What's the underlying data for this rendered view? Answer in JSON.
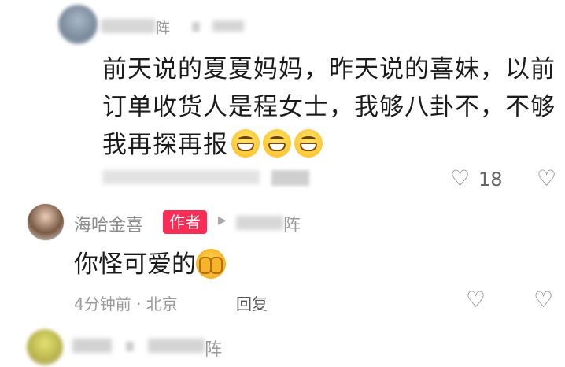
{
  "comment1": {
    "name_tail": "阵",
    "text": "前天说的夏夏妈妈，昨天说的喜妹，以前订单收货人是程女士，我够八卦不，不够我再探再报",
    "like_icon": "heart-outline-icon",
    "like_count": "18",
    "dislike_icon": "broken-heart-icon"
  },
  "comment2": {
    "name": "海哈金喜",
    "badge": "作者",
    "arrow": "▶",
    "target_tail": "阵",
    "text": "你怪可爱的",
    "time_location": "4分钟前 · 北京",
    "reply": "回复",
    "like_icon": "heart-outline-icon",
    "dislike_icon": "broken-heart-icon"
  },
  "comment3": {
    "target_tail": "阵"
  },
  "colors": {
    "badge": "#fb2c55",
    "text_primary": "#1b1b1b",
    "text_secondary": "#8c8c8c"
  }
}
